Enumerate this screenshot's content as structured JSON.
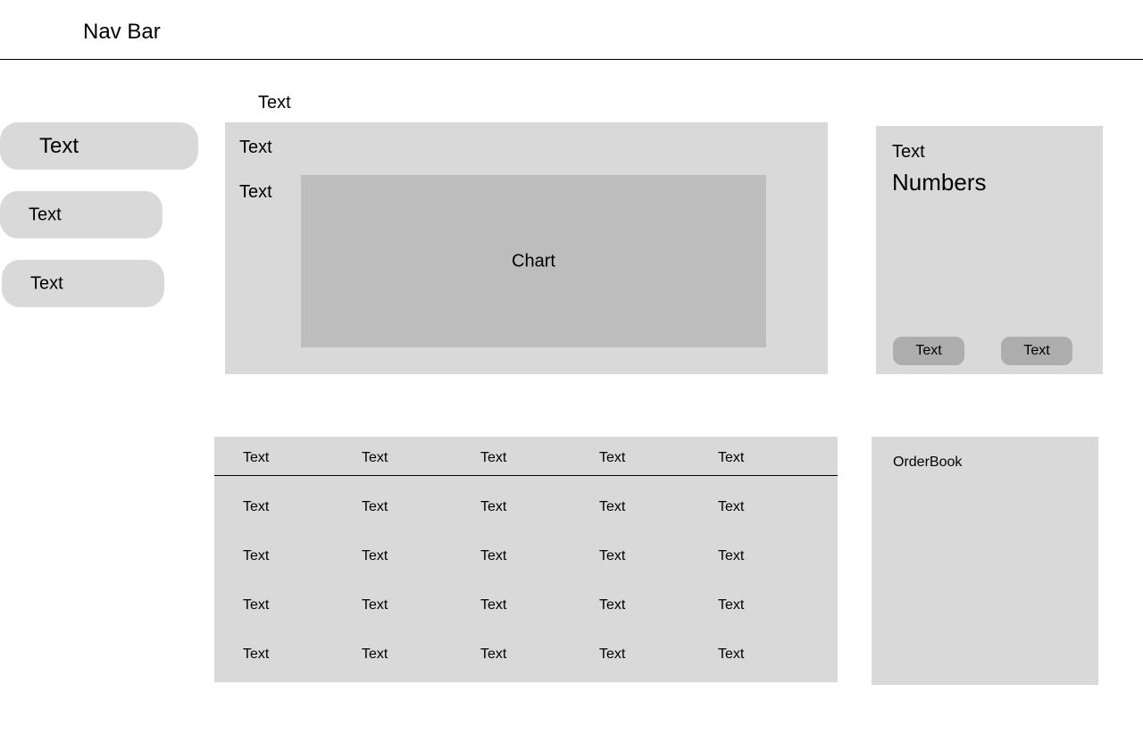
{
  "nav": {
    "title": "Nav Bar"
  },
  "sidebar": {
    "items": [
      {
        "label": "Text"
      },
      {
        "label": "Text"
      },
      {
        "label": "Text"
      }
    ]
  },
  "main": {
    "section_label": "Text",
    "chart_panel": {
      "title": "Text",
      "axis_label": "Text",
      "chart_placeholder": "Chart"
    }
  },
  "stats_panel": {
    "label": "Text",
    "value": "Numbers",
    "buttons": [
      {
        "label": "Text"
      },
      {
        "label": "Text"
      }
    ]
  },
  "table": {
    "headers": [
      "Text",
      "Text",
      "Text",
      "Text",
      "Text"
    ],
    "rows": [
      [
        "Text",
        "Text",
        "Text",
        "Text",
        "Text"
      ],
      [
        "Text",
        "Text",
        "Text",
        "Text",
        "Text"
      ],
      [
        "Text",
        "Text",
        "Text",
        "Text",
        "Text"
      ],
      [
        "Text",
        "Text",
        "Text",
        "Text",
        "Text"
      ]
    ]
  },
  "orderbook": {
    "title": "OrderBook"
  },
  "colors": {
    "panel": "#d9d9d9",
    "chart": "#bdbdbd",
    "button": "#adadad"
  }
}
